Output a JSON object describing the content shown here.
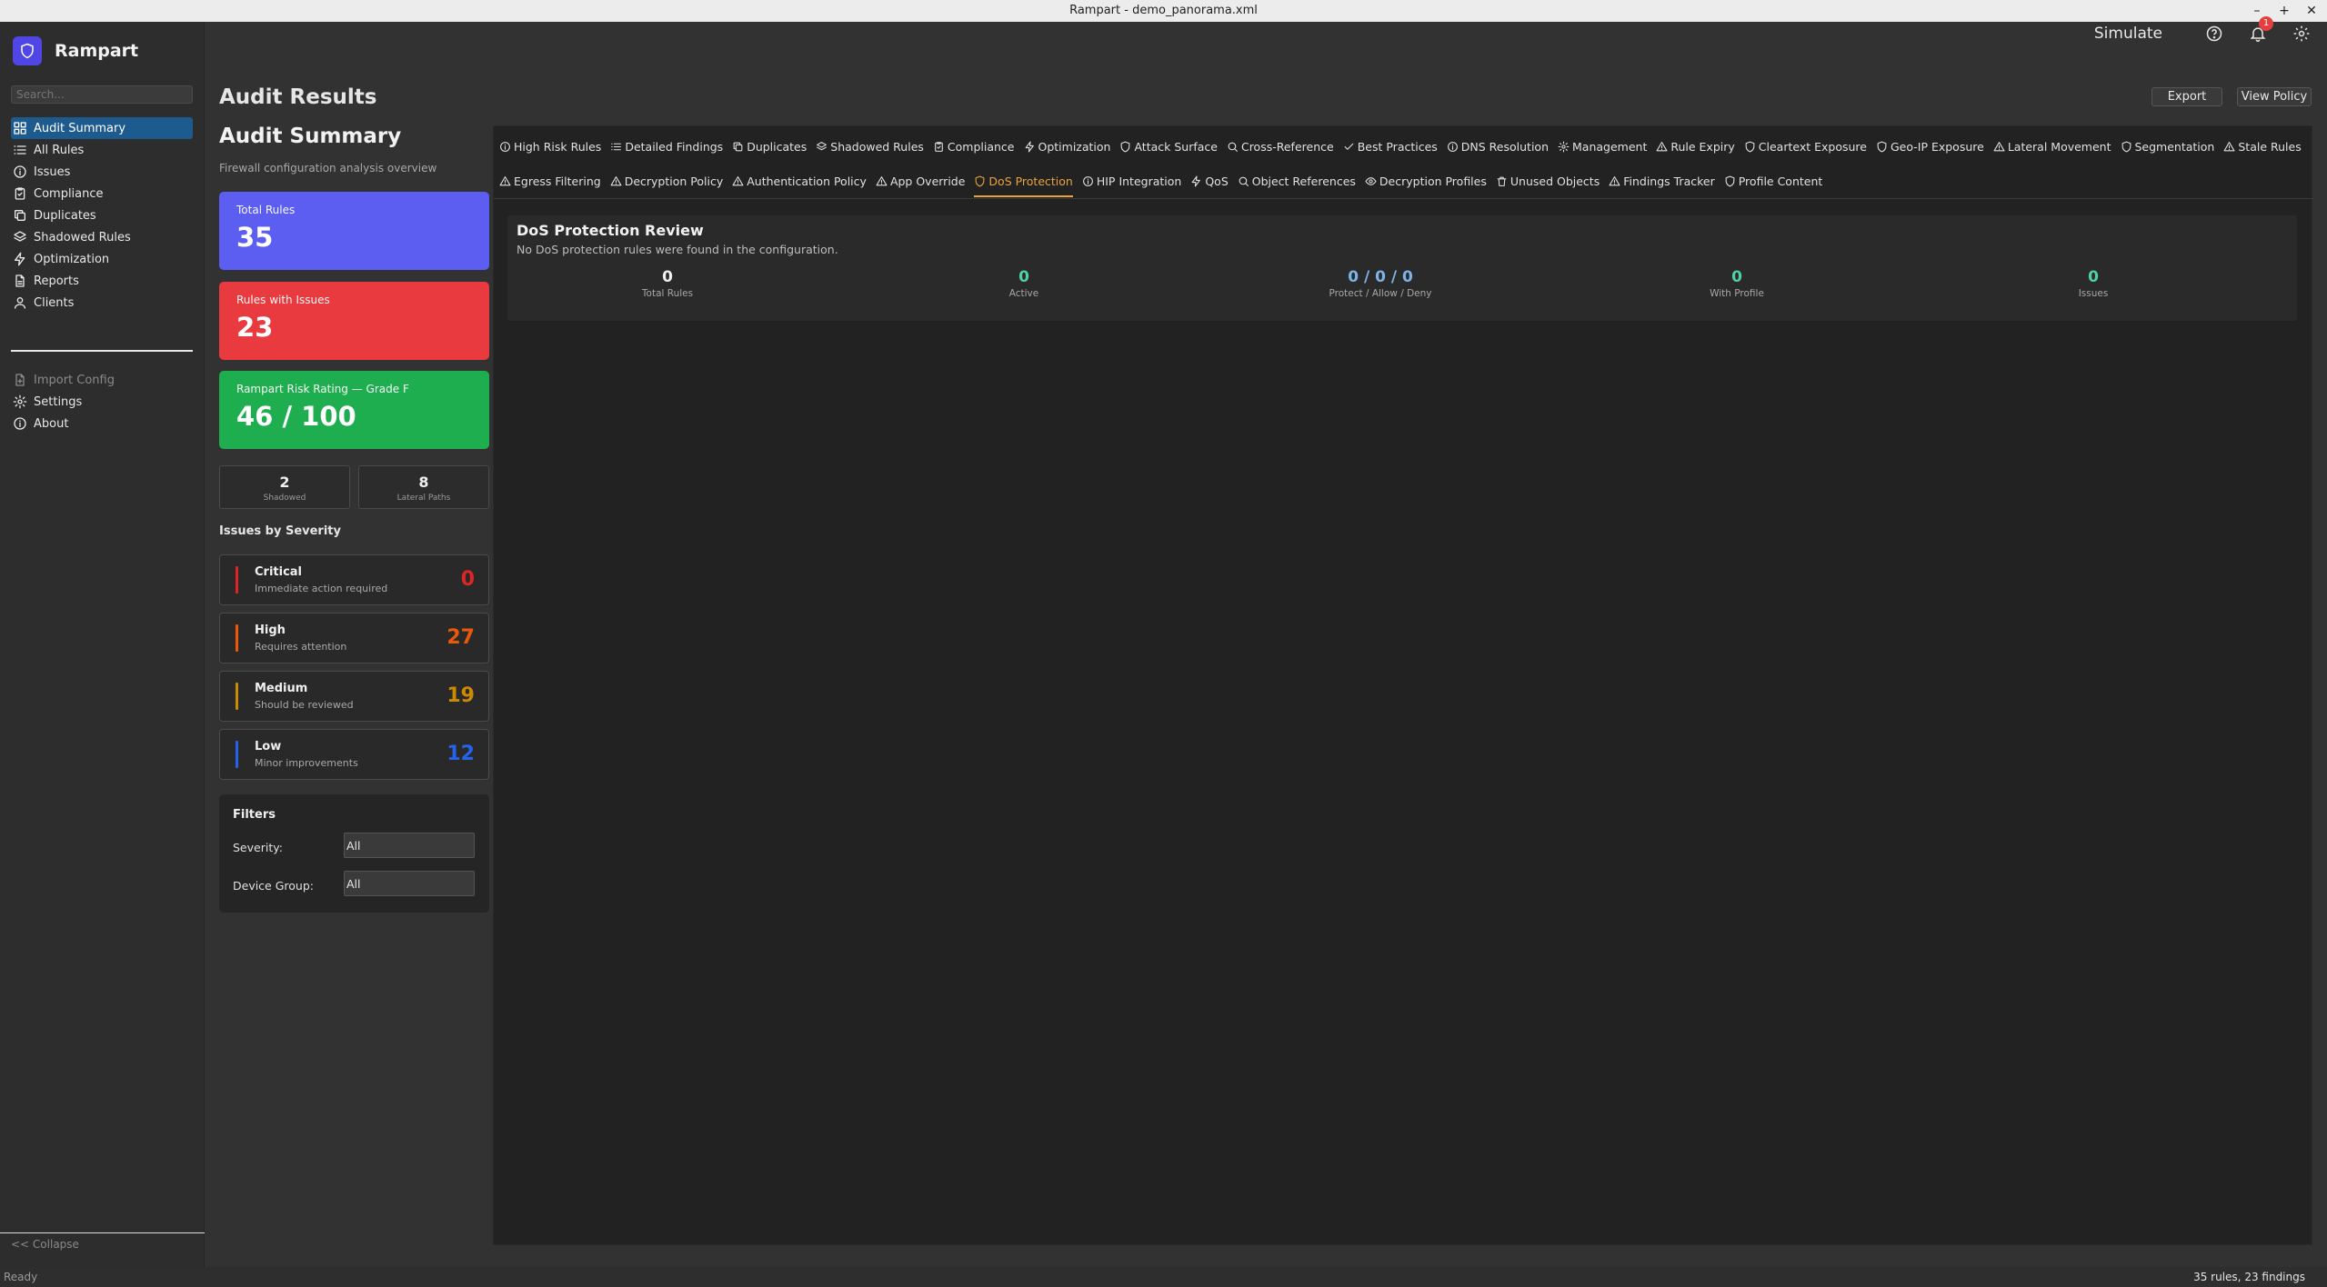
{
  "window": {
    "title": "Rampart - demo_panorama.xml"
  },
  "app": {
    "name": "Rampart",
    "accent": "#4f46e5"
  },
  "search": {
    "placeholder": "Search..."
  },
  "nav": {
    "items": [
      {
        "label": "Audit Summary",
        "icon": "grid-icon",
        "active": true
      },
      {
        "label": "All Rules",
        "icon": "list-icon"
      },
      {
        "label": "Issues",
        "icon": "info-icon"
      },
      {
        "label": "Compliance",
        "icon": "clipboard-check-icon"
      },
      {
        "label": "Duplicates",
        "icon": "copy-icon"
      },
      {
        "label": "Shadowed Rules",
        "icon": "layers-icon"
      },
      {
        "label": "Optimization",
        "icon": "zap-icon"
      },
      {
        "label": "Reports",
        "icon": "file-text-icon"
      },
      {
        "label": "Clients",
        "icon": "user-icon"
      }
    ],
    "secondary": [
      {
        "label": "Import Config",
        "icon": "file-plus-icon",
        "disabled": true
      },
      {
        "label": "Settings",
        "icon": "gear-icon"
      },
      {
        "label": "About",
        "icon": "info-icon"
      }
    ],
    "collapse_label": "<< Collapse"
  },
  "header": {
    "page_title": "Audit Results",
    "simulate_label": "Simulate",
    "notification_count": "1",
    "export_label": "Export",
    "view_policy_label": "View Policy"
  },
  "summary": {
    "title": "Audit Summary",
    "subtitle": "Firewall configuration analysis overview",
    "cards": [
      {
        "label": "Total Rules",
        "value": "35",
        "color": "#5b5ef0"
      },
      {
        "label": "Rules with Issues",
        "value": "23",
        "color": "#e83a3f"
      },
      {
        "label": "Rampart Risk Rating — Grade F",
        "value": "46 / 100",
        "color": "#1fae4f"
      }
    ],
    "mini": [
      {
        "value": "2",
        "label": "Shadowed"
      },
      {
        "value": "8",
        "label": "Lateral Paths"
      }
    ],
    "severity_title": "Issues by Severity",
    "severity": [
      {
        "name": "Critical",
        "desc": "Immediate action required",
        "count": "0",
        "color": "#dc2626"
      },
      {
        "name": "High",
        "desc": "Requires attention",
        "count": "27",
        "color": "#ea580c"
      },
      {
        "name": "Medium",
        "desc": "Should be reviewed",
        "count": "19",
        "color": "#ca8a04"
      },
      {
        "name": "Low",
        "desc": "Minor improvements",
        "count": "12",
        "color": "#2563eb"
      }
    ],
    "filters": {
      "title": "Filters",
      "severity_label": "Severity:",
      "severity_value": "All",
      "device_group_label": "Device Group:",
      "device_group_value": "All"
    }
  },
  "tabs": {
    "row1": [
      {
        "label": "High Risk Rules",
        "icon": "info-icon"
      },
      {
        "label": "Detailed Findings",
        "icon": "list-icon"
      },
      {
        "label": "Duplicates",
        "icon": "copy-icon"
      },
      {
        "label": "Shadowed Rules",
        "icon": "layers-icon"
      },
      {
        "label": "Compliance",
        "icon": "clipboard-check-icon"
      },
      {
        "label": "Optimization",
        "icon": "zap-icon"
      },
      {
        "label": "Attack Surface",
        "icon": "shield-icon"
      },
      {
        "label": "Cross-Reference",
        "icon": "search-icon"
      },
      {
        "label": "Best Practices",
        "icon": "check-icon"
      },
      {
        "label": "DNS Resolution",
        "icon": "info-icon"
      },
      {
        "label": "Management",
        "icon": "gear-icon"
      },
      {
        "label": "Rule Expiry",
        "icon": "warning-icon"
      },
      {
        "label": "Cleartext Exposure",
        "icon": "shield-icon"
      },
      {
        "label": "Geo-IP Exposure",
        "icon": "shield-icon"
      },
      {
        "label": "Lateral Movement",
        "icon": "warning-icon"
      },
      {
        "label": "Segmentation",
        "icon": "shield-icon"
      },
      {
        "label": "Stale Rules",
        "icon": "warning-icon"
      }
    ],
    "row2": [
      {
        "label": "Egress Filtering",
        "icon": "warning-icon"
      },
      {
        "label": "Decryption Policy",
        "icon": "warning-icon"
      },
      {
        "label": "Authentication Policy",
        "icon": "warning-icon"
      },
      {
        "label": "App Override",
        "icon": "warning-icon"
      },
      {
        "label": "DoS Protection",
        "icon": "shield-icon",
        "active": true
      },
      {
        "label": "HIP Integration",
        "icon": "info-icon"
      },
      {
        "label": "QoS",
        "icon": "zap-icon"
      },
      {
        "label": "Object References",
        "icon": "search-icon"
      },
      {
        "label": "Decryption Profiles",
        "icon": "eye-icon"
      },
      {
        "label": "Unused Objects",
        "icon": "trash-icon"
      },
      {
        "label": "Findings Tracker",
        "icon": "warning-icon"
      },
      {
        "label": "Profile Content",
        "icon": "shield-icon"
      }
    ]
  },
  "dos": {
    "title": "DoS Protection Review",
    "subtitle": "No DoS protection rules were found in the configuration.",
    "stats": [
      {
        "value": "0",
        "label": "Total Rules",
        "color": "#f0f0f0"
      },
      {
        "value": "0",
        "label": "Active",
        "color": "#4fd1a5"
      },
      {
        "value": "0 / 0 / 0",
        "label": "Protect / Allow / Deny",
        "color": "#7fb3e8"
      },
      {
        "value": "0",
        "label": "With Profile",
        "color": "#4fd1a5"
      },
      {
        "value": "0",
        "label": "Issues",
        "color": "#4fd1a5"
      }
    ]
  },
  "status": {
    "left": "Ready",
    "right": "35 rules, 23 findings"
  }
}
